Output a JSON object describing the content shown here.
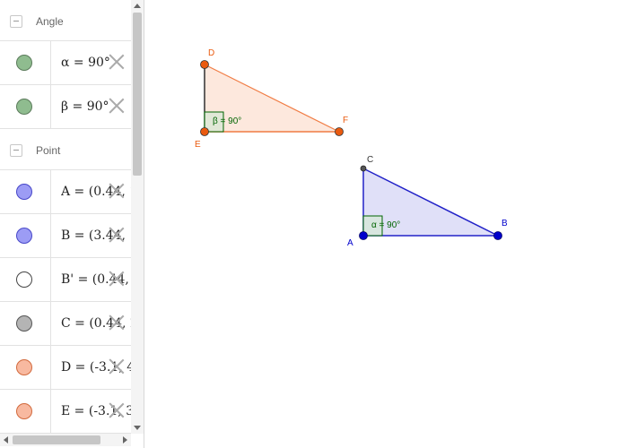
{
  "algebra_view": {
    "groups": [
      {
        "title": "Angle",
        "items": [
          {
            "expr": "α = 90°",
            "color": "#8fbc8f",
            "border": "#5a7a5a"
          },
          {
            "expr": "β = 90°",
            "color": "#8fbc8f",
            "border": "#5a7a5a"
          }
        ]
      },
      {
        "title": "Point",
        "items": [
          {
            "expr": "A = (0.44, 1",
            "color": "#9c9cf5",
            "border": "#4646c8"
          },
          {
            "expr": "B = (3.44, 1",
            "color": "#9c9cf5",
            "border": "#4646c8"
          },
          {
            "expr": "B' = (0.44, 4",
            "color": "#ffffff",
            "border": "#444444"
          },
          {
            "expr": "C = (0.44, 2.",
            "color": "#b4b4b4",
            "border": "#555555"
          },
          {
            "expr": "D = (-3.1, 4.",
            "color": "#f8b9a0",
            "border": "#d2693c"
          },
          {
            "expr": "E = (-3.1, 3.",
            "color": "#f8b9a0",
            "border": "#d2693c"
          }
        ]
      }
    ]
  },
  "graphics": {
    "triangle_orange": {
      "fill": "#fde8dd",
      "stroke": "#f07b43",
      "point_color": "#ea5a0f",
      "labels": {
        "D": "D",
        "E": "E",
        "F": "F"
      },
      "angle_label": "β = 90°"
    },
    "triangle_blue": {
      "fill": "#e0e0f8",
      "stroke": "#2323c8",
      "point_color": "#0000cc",
      "labels": {
        "A": "A",
        "B": "B",
        "C": "C"
      },
      "angle_label": "α = 90°"
    },
    "angle_color": "#006400"
  }
}
